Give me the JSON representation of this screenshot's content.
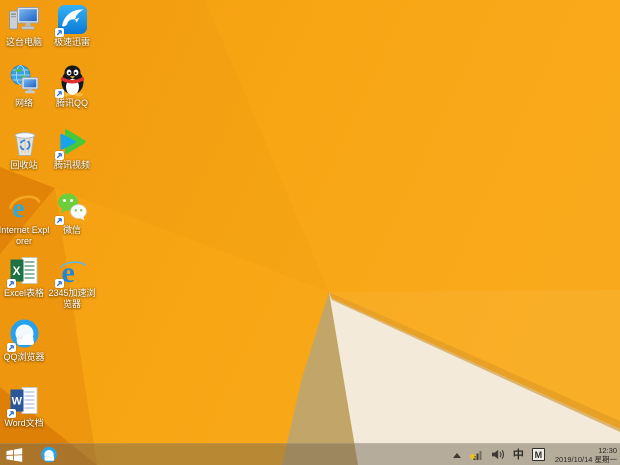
{
  "wallpaper": {
    "base_orange": "#f8a614",
    "left_band": "#ee960e",
    "upper_left_facet": "#e28408",
    "lower_left_facet": "#de8006",
    "shadow_facet": "#c2a569",
    "cream_facet": "#f3eada",
    "ridge_gold": "#e9a125"
  },
  "desktop": {
    "icons": [
      {
        "label": "这台电脑",
        "icon": "computer-icon"
      },
      {
        "label": "极速迅雷",
        "icon": "thunder-icon"
      },
      {
        "label": "网络",
        "icon": "network-globe-icon"
      },
      {
        "label": "腾讯QQ",
        "icon": "qq-penguin-icon"
      },
      {
        "label": "回收站",
        "icon": "recycle-bin-icon"
      },
      {
        "label": "腾讯视频",
        "icon": "tencent-video-icon"
      },
      {
        "label": "Internet Explorer",
        "icon": "ie-icon"
      },
      {
        "label": "微信",
        "icon": "wechat-icon"
      },
      {
        "label": "Excel表格",
        "icon": "excel-icon"
      },
      {
        "label": "2345加速浏览器",
        "icon": "2345-browser-icon"
      },
      {
        "label": "QQ浏览器",
        "icon": "qq-browser-icon"
      },
      {
        "label": "Word文档",
        "icon": "word-icon"
      }
    ]
  },
  "taskbar": {
    "tray": {
      "lang_indicator": "中",
      "ime_indicator": "M",
      "time": "12:30",
      "date": "2019/10/14 星期一"
    }
  }
}
